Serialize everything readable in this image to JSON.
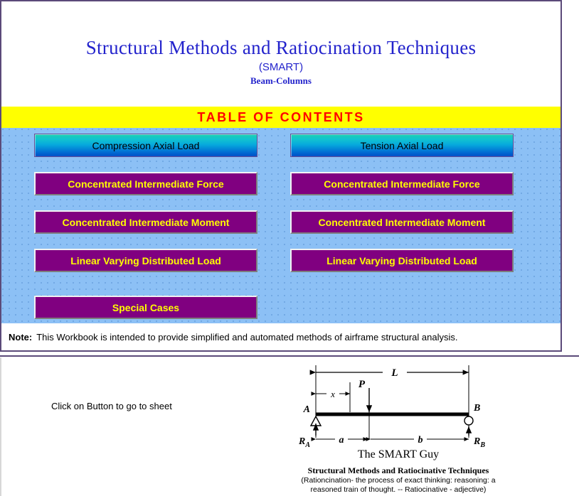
{
  "header": {
    "title": "Structural Methods and Ratiocination Techniques",
    "acronym": "(SMART)",
    "subject": "Beam-Columns",
    "title_color": "#2323CC"
  },
  "toc": {
    "banner_label": "TABLE  OF  CONTENTS",
    "banner_bg": "#FFFF00",
    "banner_text_color": "#FF0000",
    "panel_bg": "#8CC0F5",
    "columns": [
      {
        "header_button": {
          "label": "Compression Axial Load",
          "style": "gradient",
          "gradient_from": "#1CCFB0",
          "gradient_to": "#0050C8",
          "text_color": "#000000"
        },
        "buttons": [
          {
            "label": "Concentrated Intermediate Force",
            "bg": "#800080",
            "text_color": "#FFFF00"
          },
          {
            "label": "Concentrated Intermediate Moment",
            "bg": "#800080",
            "text_color": "#FFFF00"
          },
          {
            "label": "Linear Varying Distributed Load",
            "bg": "#800080",
            "text_color": "#FFFF00"
          },
          {
            "label": "Special Cases",
            "bg": "#800080",
            "text_color": "#FFFF00"
          }
        ]
      },
      {
        "header_button": {
          "label": "Tension Axial Load",
          "style": "gradient",
          "gradient_from": "#1CCFB0",
          "gradient_to": "#0050C8",
          "text_color": "#000000"
        },
        "buttons": [
          {
            "label": "Concentrated Intermediate Force",
            "bg": "#800080",
            "text_color": "#FFFF00"
          },
          {
            "label": "Concentrated Intermediate Moment",
            "bg": "#800080",
            "text_color": "#FFFF00"
          },
          {
            "label": "Linear Varying Distributed Load",
            "bg": "#800080",
            "text_color": "#FFFF00"
          }
        ]
      }
    ]
  },
  "note": {
    "label": "Note:",
    "text": "This Workbook is intended to provide simplified and automated methods of airframe structural analysis."
  },
  "bottom": {
    "click_hint": "Click on Button to go to sheet",
    "caption_title": "The SMART Guy",
    "caption_bold": "Structural Methods and Ratiocinative Techniques",
    "caption_line1": "(Rationcination- the process of exact thinking: reasoning: a",
    "caption_line2": "reasoned train of thought.  -- Ratiocinative - adjective)"
  },
  "diagram": {
    "labels": {
      "span_total": "L",
      "distance_x": "x",
      "load": "P",
      "node_a": "A",
      "node_b": "B",
      "reaction_a": "R",
      "reaction_a_sub": "A",
      "reaction_b": "R",
      "reaction_b_sub": "B",
      "seg_a": "a",
      "seg_b": "b"
    }
  }
}
